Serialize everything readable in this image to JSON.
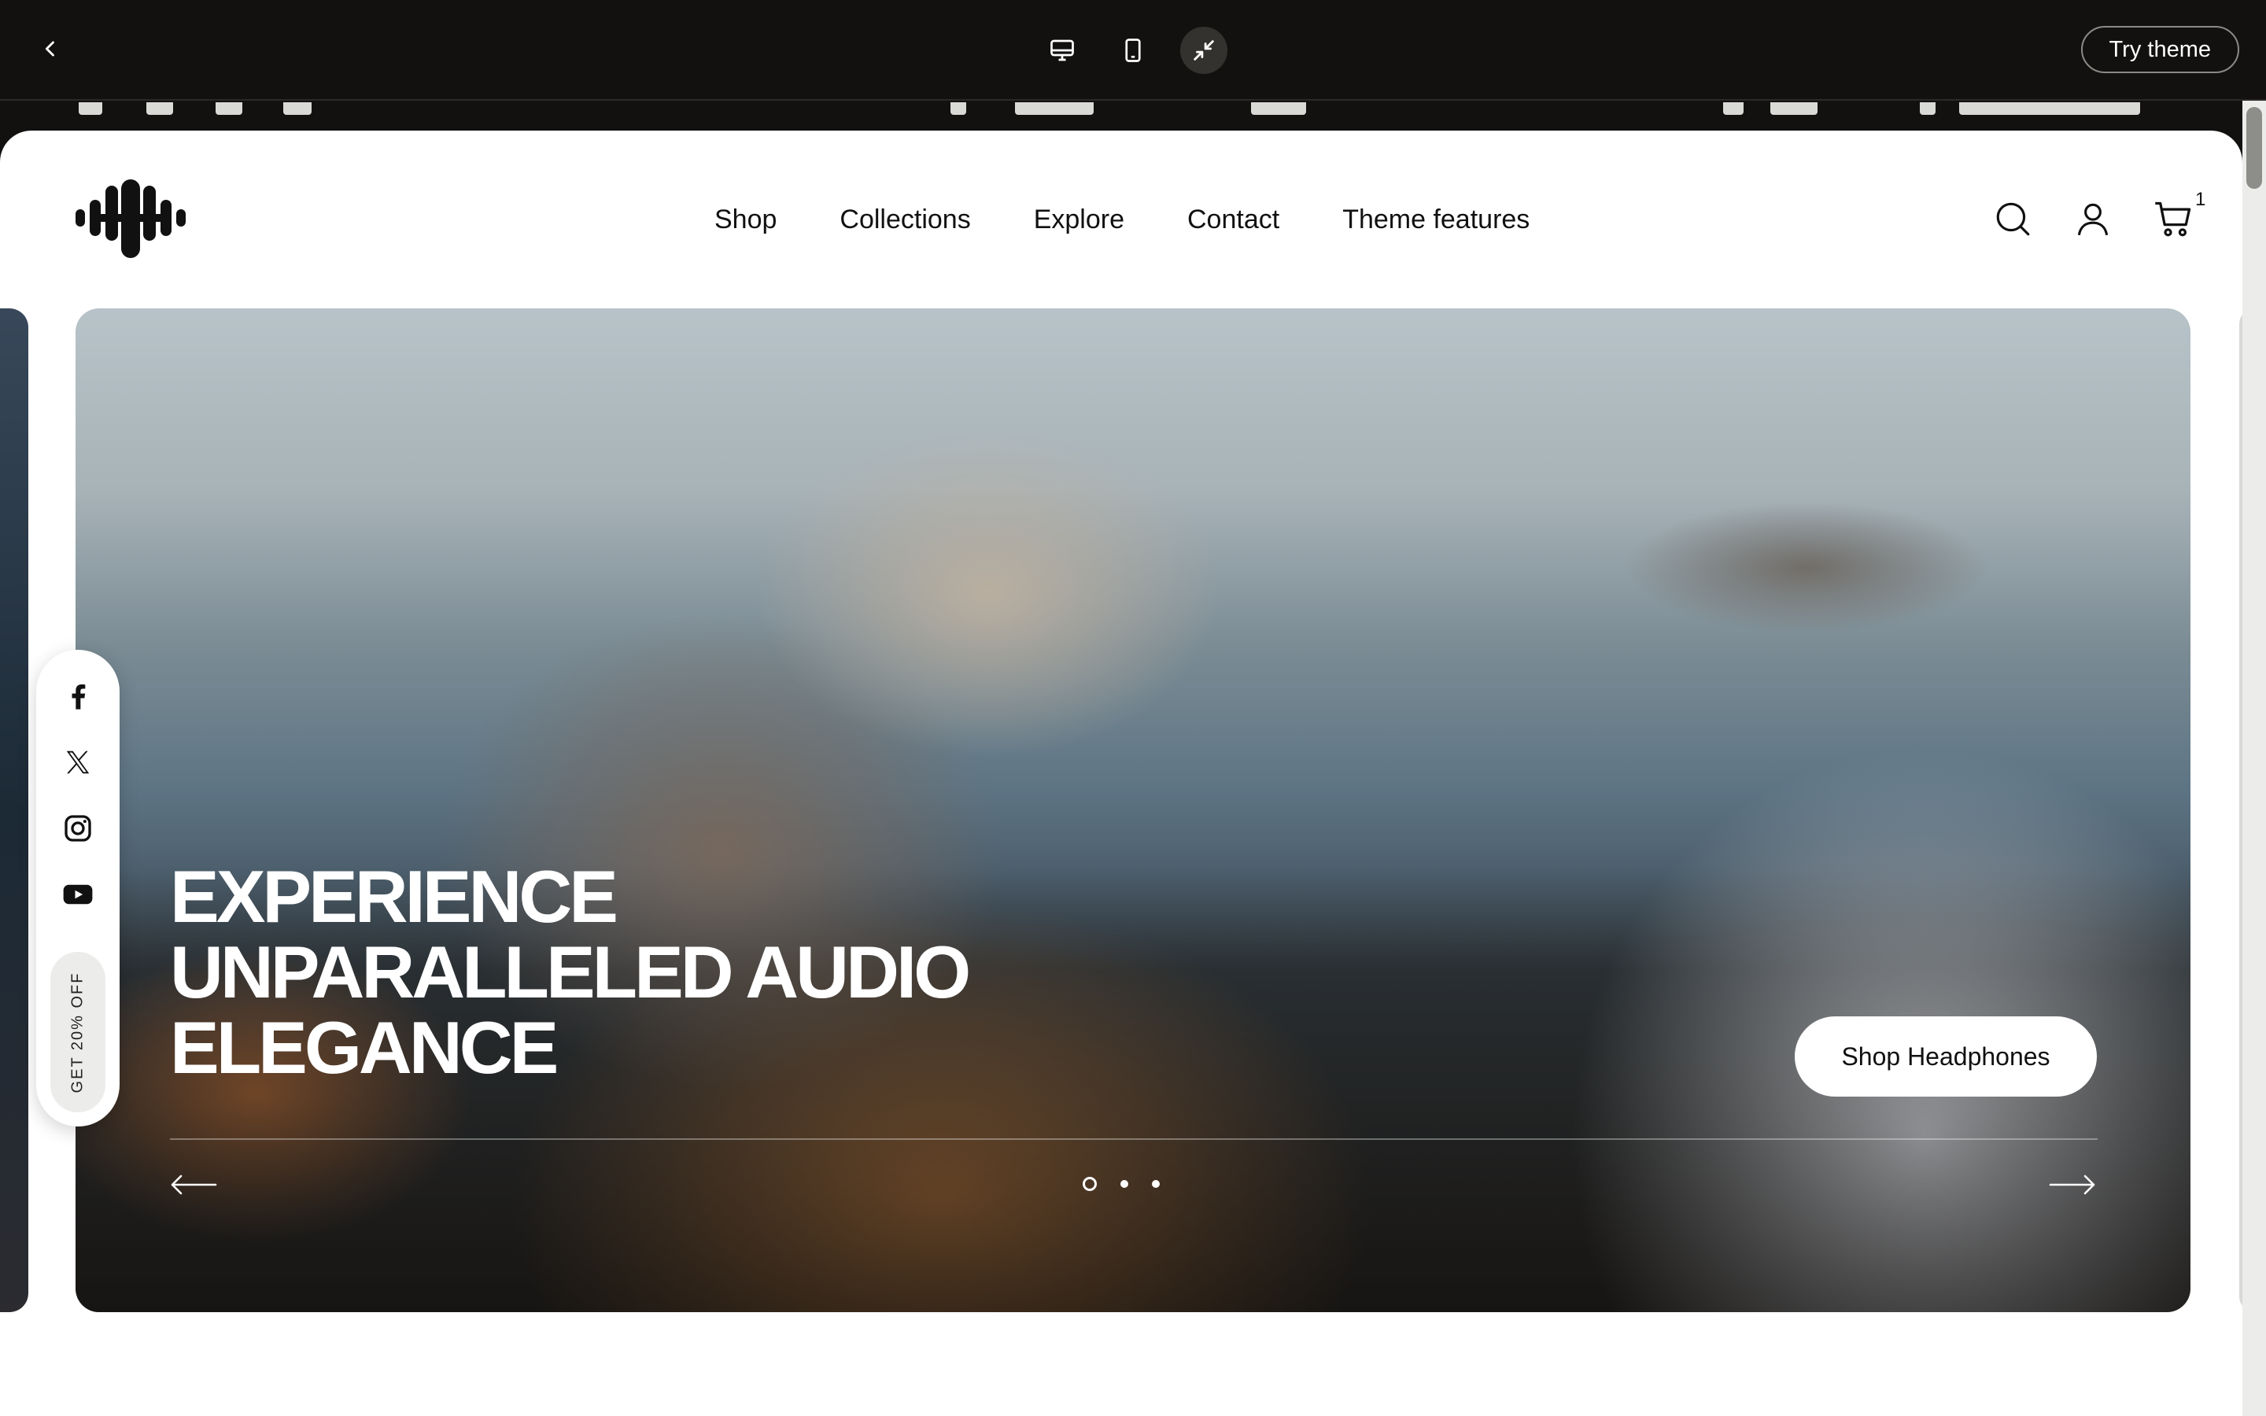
{
  "toolbar": {
    "try_theme": "Try theme"
  },
  "nav": {
    "items": [
      "Shop",
      "Collections",
      "Explore",
      "Contact",
      "Theme features"
    ]
  },
  "header": {
    "cart_count": "1"
  },
  "hero": {
    "title_lines": [
      "EXPERIENCE",
      "UNPARALLELED AUDIO",
      "ELEGANCE"
    ],
    "cta": "Shop Headphones",
    "slide_count": 3,
    "active_slide": 1
  },
  "social_bar": {
    "promo": "GET 20% OFF"
  },
  "colors": {
    "toolbar_bg": "#121110",
    "page_bg": "#ffffff",
    "text": "#111111",
    "accent": "#ffffff"
  }
}
